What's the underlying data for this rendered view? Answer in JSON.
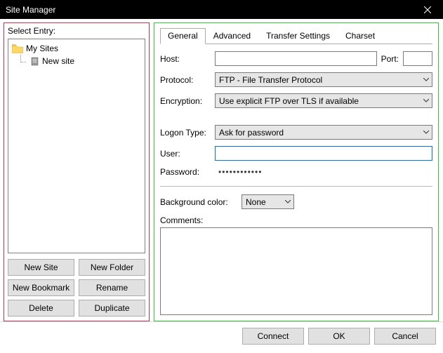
{
  "window": {
    "title": "Site Manager"
  },
  "left": {
    "label": "Select Entry:",
    "root": "My Sites",
    "child": "New site",
    "buttons": {
      "new_site": "New Site",
      "new_folder": "New Folder",
      "new_bookmark": "New Bookmark",
      "rename": "Rename",
      "delete": "Delete",
      "duplicate": "Duplicate"
    }
  },
  "tabs": {
    "general": "General",
    "advanced": "Advanced",
    "transfer": "Transfer Settings",
    "charset": "Charset"
  },
  "form": {
    "host_label": "Host:",
    "host_value": "",
    "port_label": "Port:",
    "port_value": "",
    "protocol_label": "Protocol:",
    "protocol_value": "FTP - File Transfer Protocol",
    "encryption_label": "Encryption:",
    "encryption_value": "Use explicit FTP over TLS if available",
    "logon_label": "Logon Type:",
    "logon_value": "Ask for password",
    "user_label": "User:",
    "user_value": "",
    "password_label": "Password:",
    "password_value": "••••••••••••",
    "bgcolor_label": "Background color:",
    "bgcolor_value": "None",
    "comments_label": "Comments:",
    "comments_value": ""
  },
  "footer": {
    "connect": "Connect",
    "ok": "OK",
    "cancel": "Cancel"
  }
}
